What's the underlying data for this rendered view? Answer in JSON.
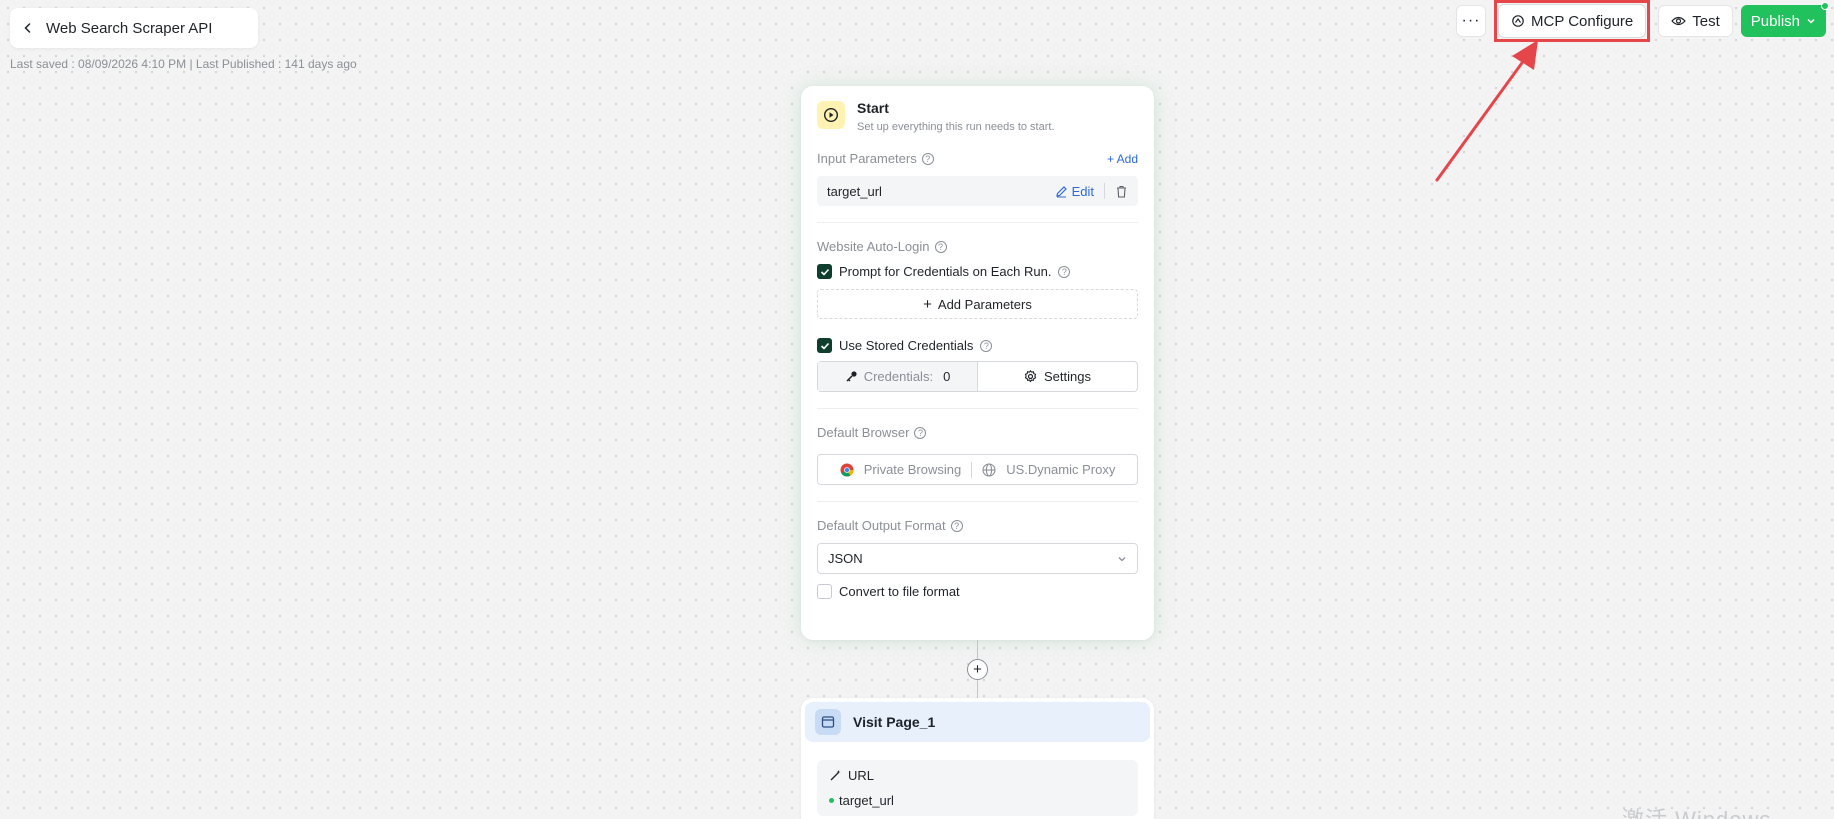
{
  "header": {
    "workflow_name": "Web Search Scraper API",
    "save_info": "Last saved : 08/09/2026 4:10 PM | Last Published : 141 days ago"
  },
  "toolbar": {
    "more_label": "···",
    "mcp_label": "MCP Configure",
    "test_label": "Test",
    "publish_label": "Publish"
  },
  "start_node": {
    "title": "Start",
    "subtitle": "Set up everything this run needs to start.",
    "input_params_label": "Input Parameters",
    "add_label": "Add",
    "params": [
      {
        "name": "target_url",
        "edit_label": "Edit"
      }
    ],
    "auto_login_label": "Website Auto-Login",
    "prompt_credentials_label": "Prompt for Credentials on Each Run.",
    "prompt_credentials_checked": true,
    "add_parameters_label": "Add Parameters",
    "stored_credentials_label": "Use Stored Credentials",
    "stored_credentials_checked": true,
    "credentials_label": "Credentials:",
    "credentials_count": "0",
    "settings_label": "Settings",
    "default_browser_label": "Default Browser",
    "browser_mode": "Private Browsing",
    "proxy": "US.Dynamic Proxy",
    "output_format_label": "Default Output Format",
    "output_format": "JSON",
    "convert_label": "Convert to file format",
    "convert_checked": false
  },
  "connector": {
    "plus_label": "+"
  },
  "visit_node": {
    "title": "Visit Page_1",
    "url_label": "URL",
    "url_value": "target_url"
  },
  "watermark": "激活 Windows",
  "colors": {
    "accent_blue": "#2d6ad6",
    "publish_green": "#21c25e",
    "highlight_red": "#e5464a",
    "checkbox_dark": "#0f3d2e"
  }
}
